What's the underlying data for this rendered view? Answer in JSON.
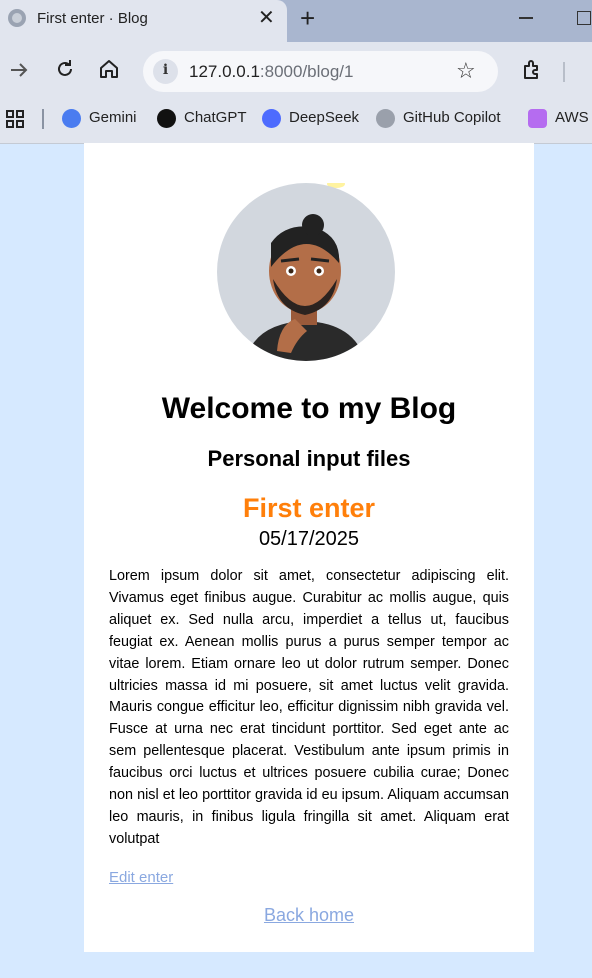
{
  "browser": {
    "tab_title": "First enter · Blog",
    "url_host": "127.0.0.1",
    "url_rest": ":8000/blog/1",
    "bookmarks": [
      {
        "label": "Gemini",
        "color": "#4a7cf0"
      },
      {
        "label": "ChatGPT",
        "color": "#111111"
      },
      {
        "label": "DeepSeek",
        "color": "#4d6bfe"
      },
      {
        "label": "GitHub Copilot",
        "color": "#9aa0ab"
      },
      {
        "label": "AWS",
        "color": "#b56cf0"
      }
    ]
  },
  "page": {
    "blog_title": "Welcome to my Blog",
    "blog_subtitle": "Personal input files",
    "post_title": "First enter",
    "post_date": "05/17/2025",
    "post_body": "Lorem ipsum dolor sit amet, consectetur adipiscing elit. Vivamus eget finibus augue. Curabitur ac mollis augue, quis aliquet ex. Sed nulla arcu, imperdiet a tellus ut, faucibus feugiat ex. Aenean mollis purus a purus semper tempor ac vitae lorem. Etiam ornare leo ut dolor rutrum semper. Donec ultricies massa id mi posuere, sit amet luctus velit gravida. Mauris congue efficitur leo, efficitur dignissim nibh gravida vel. Fusce at urna nec erat tincidunt porttitor. Sed eget ante ac sem pellentesque placerat. Vestibulum ante ipsum primis in faucibus orci luctus et ultrices posuere cubilia curae; Donec non nisl et leo porttitor gravida id eu ipsum. Aliquam accumsan leo mauris, in finibus ligula fringilla sit amet. Aliquam erat volutpat",
    "edit_link": "Edit enter",
    "back_link": "Back home"
  },
  "colors": {
    "page_background": "#d6e9ff",
    "post_title": "#ff7f0a",
    "link": "#8aa8e0"
  }
}
